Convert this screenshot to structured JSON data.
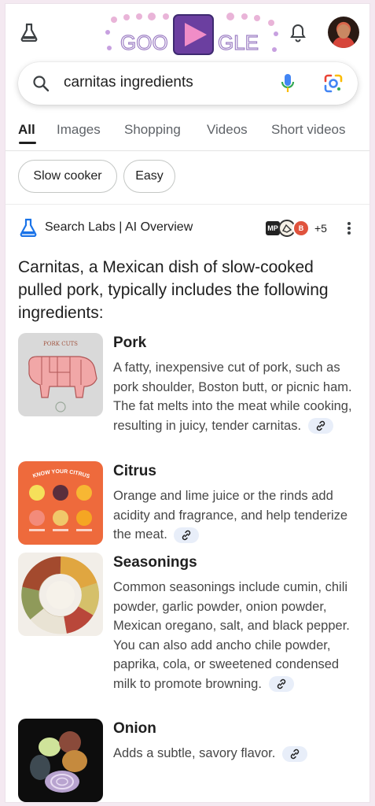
{
  "header": {
    "labs_icon": "flask-icon",
    "doodle_text": [
      "GOO",
      "GLE"
    ],
    "notifications_icon": "bell-icon",
    "avatar": "account-avatar"
  },
  "search": {
    "query": "carnitas ingredients",
    "search_icon": "search-icon",
    "voice_icon": "mic-icon",
    "lens_icon": "google-lens-icon"
  },
  "tabs": [
    {
      "label": "All",
      "active": true
    },
    {
      "label": "Images"
    },
    {
      "label": "Shopping"
    },
    {
      "label": "Videos"
    },
    {
      "label": "Short videos"
    }
  ],
  "chips": [
    "Slow cooker",
    "Easy"
  ],
  "ai_overview": {
    "title": "Search Labs | AI Overview",
    "sources_more": "+5",
    "source_badges": [
      "MP",
      "",
      "B"
    ],
    "summary": "Carnitas, a Mexican dish of slow-cooked pulled pork, typically includes the following ingredients:",
    "items": [
      {
        "name": "Pork",
        "description": "A fatty, inexpensive cut of pork, such as pork shoulder, Boston butt, or picnic ham. The fat melts into the meat while cooking, resulting in juicy, tender carnitas.",
        "thumb_label": "PORK CUTS"
      },
      {
        "name": "Citrus",
        "description": "Orange and lime juice or the rinds add acidity and fragrance, and help tenderize the meat.",
        "thumb_label": "KNOW YOUR CITRUS"
      },
      {
        "name": "Seasonings",
        "description": "Common seasonings include cumin, chili powder, garlic powder, onion powder, Mexican oregano, salt, and black pepper. You can also add ancho chile powder, paprika, cola, or sweetened condensed milk to promote browning.",
        "thumb_label": ""
      },
      {
        "name": "Onion",
        "description": "Adds a subtle, savory flavor.",
        "thumb_label": ""
      }
    ]
  },
  "colors": {
    "accent_blue": "#1a73e8",
    "link_chip_bg": "#e8eef9",
    "doodle_purple": "#b084c8"
  }
}
